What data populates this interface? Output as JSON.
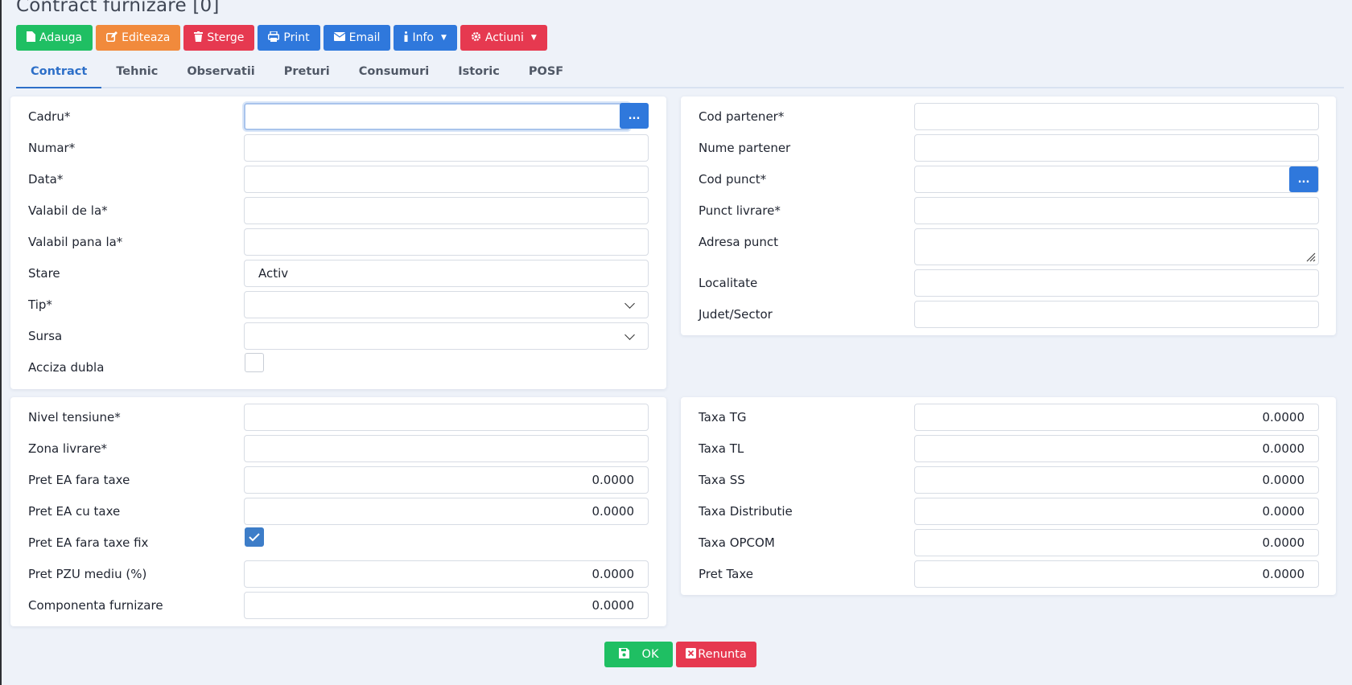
{
  "header": {
    "title": "Contract furnizare [0]"
  },
  "toolbar": {
    "add": "Adauga",
    "edit": "Editeaza",
    "delete": "Sterge",
    "print": "Print",
    "email": "Email",
    "info": "Info",
    "actions": "Actiuni"
  },
  "tabs": [
    "Contract",
    "Tehnic",
    "Observatii",
    "Preturi",
    "Consumuri",
    "Istoric",
    "POSF"
  ],
  "contract": {
    "cadru_label": "Cadru*",
    "cadru_value": "",
    "numar_label": "Numar*",
    "numar_value": "",
    "data_label": "Data*",
    "data_value": "",
    "valabil_de_la_label": "Valabil de la*",
    "valabil_de_la_value": "",
    "valabil_pana_la_label": "Valabil pana la*",
    "valabil_pana_la_value": "",
    "stare_label": "Stare",
    "stare_value": "Activ",
    "tip_label": "Tip*",
    "tip_value": "",
    "sursa_label": "Sursa",
    "sursa_value": "",
    "acciza_label": "Acciza dubla",
    "acciza_checked": false
  },
  "partner": {
    "cod_partener_label": "Cod partener*",
    "nume_partener_label": "Nume partener",
    "cod_punct_label": "Cod punct*",
    "punct_livrare_label": "Punct livrare*",
    "adresa_punct_label": "Adresa punct",
    "localitate_label": "Localitate",
    "judet_label": "Judet/Sector"
  },
  "prices": {
    "nivel_tensiune_label": "Nivel tensiune*",
    "zona_livrare_label": "Zona livrare*",
    "pret_fara_taxe_label": "Pret EA fara taxe",
    "pret_fara_taxe_value": "0.0000",
    "pret_cu_taxe_label": "Pret EA cu taxe",
    "pret_cu_taxe_value": "0.0000",
    "pret_fix_label": "Pret EA fara taxe fix",
    "pret_fix_checked": true,
    "pret_pzu_label": "Pret PZU mediu (%)",
    "pret_pzu_value": "0.0000",
    "componenta_label": "Componenta furnizare",
    "componenta_value": "0.0000"
  },
  "taxes": {
    "tg_label": "Taxa TG",
    "tg_value": "0.0000",
    "tl_label": "Taxa TL",
    "tl_value": "0.0000",
    "ss_label": "Taxa SS",
    "ss_value": "0.0000",
    "distributie_label": "Taxa Distributie",
    "distributie_value": "0.0000",
    "opcom_label": "Taxa OPCOM",
    "opcom_value": "0.0000",
    "pret_taxe_label": "Pret Taxe",
    "pret_taxe_value": "0.0000"
  },
  "footer": {
    "ok": "OK",
    "cancel": "Renunta"
  },
  "icons": {
    "dots": "..."
  },
  "colors": {
    "green": "#1fbf63",
    "orange": "#f18a3c",
    "red": "#e63950",
    "blue": "#2f78dc",
    "tab_active": "#2d6fc8"
  }
}
